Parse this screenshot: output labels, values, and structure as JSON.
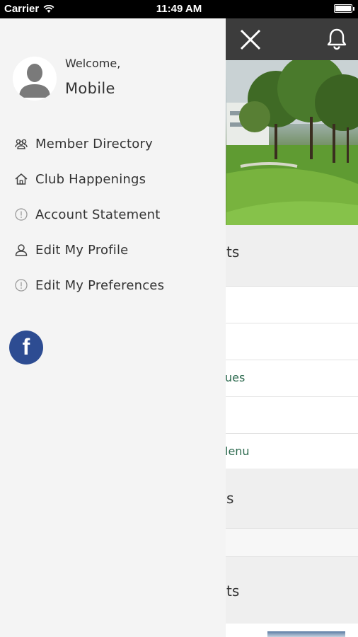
{
  "status_bar": {
    "carrier": "Carrier",
    "time": "11:49 AM"
  },
  "drawer": {
    "welcome": "Welcome,",
    "user_name": "Mobile",
    "menu": [
      {
        "label": "Member Directory",
        "icon": "members-icon"
      },
      {
        "label": "Club Happenings",
        "icon": "home-icon"
      },
      {
        "label": "Account Statement",
        "icon": "info-icon"
      },
      {
        "label": "Edit My Profile",
        "icon": "user-icon"
      },
      {
        "label": "Edit My Preferences",
        "icon": "info-icon"
      }
    ],
    "social": {
      "facebook": "f"
    }
  },
  "background_page": {
    "sections": [
      {
        "label": "ts"
      },
      {
        "label": "s"
      },
      {
        "label": "ts"
      }
    ],
    "rows": [
      {
        "label": ""
      },
      {
        "label": ""
      },
      {
        "label": "ues"
      },
      {
        "label": ""
      },
      {
        "label": "lenu"
      },
      {
        "label": ""
      }
    ]
  },
  "colors": {
    "drawer_bg": "#f4f4f4",
    "topbar_bg": "#3c3c3c",
    "facebook_blue": "#2d4c92",
    "link_green": "#2d6a4f"
  }
}
